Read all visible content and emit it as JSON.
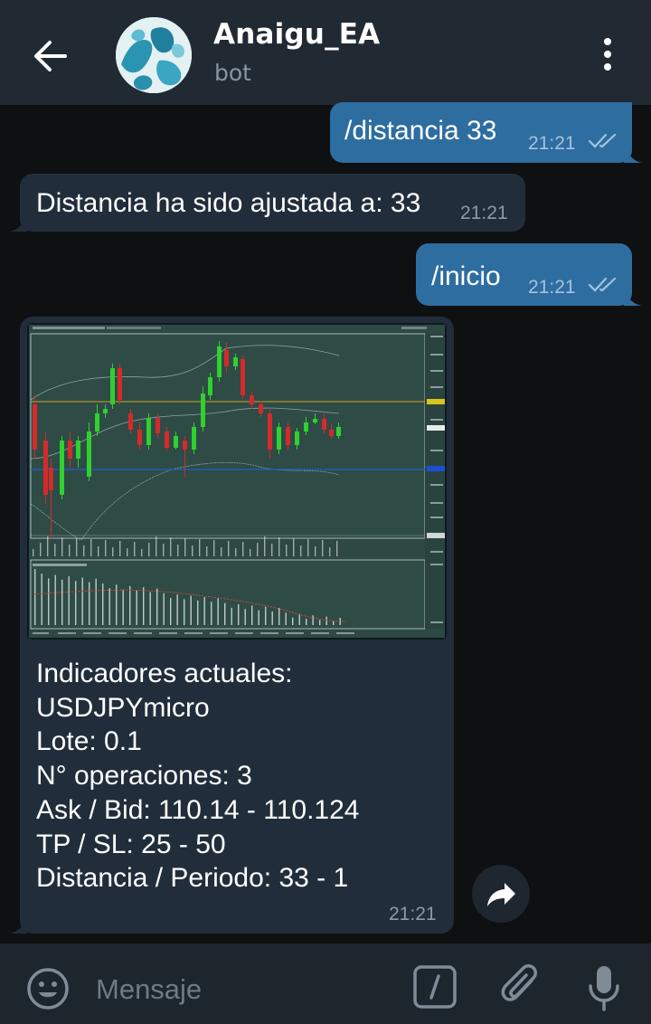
{
  "header": {
    "title": "Anaigu_EA",
    "subtitle": "bot",
    "avatar_icon": "bot-avatar-image"
  },
  "messages": [
    {
      "direction": "out",
      "text": "/distancia 33",
      "time": "21:21",
      "status": "read"
    },
    {
      "direction": "in",
      "text": "Distancia ha sido ajustada a: 33",
      "time": "21:21"
    },
    {
      "direction": "out",
      "text": "/inicio",
      "time": "21:21",
      "status": "read"
    },
    {
      "direction": "in",
      "type": "photo",
      "caption_lines": [
        "Indicadores actuales:",
        "USDJPYmicro",
        "Lote: 0.1",
        "N° operaciones: 3",
        "Ask / Bid: 110.14 - 110.124",
        "TP / SL: 25 - 50",
        "Distancia / Periodo: 33 - 1"
      ],
      "time": "21:21",
      "chart_colors": {
        "background": "#0a1416",
        "bull": "#2fd12f",
        "bear": "#d42a2a",
        "level": "#c8a520",
        "bid_line": "#1c5fd0"
      }
    }
  ],
  "input": {
    "placeholder": "Mensaje"
  },
  "icons": {
    "back": "arrow-left-icon",
    "menu": "more-vertical-icon",
    "forward": "share-forward-icon",
    "emoji": "emoji-icon",
    "command": "slash-command-icon",
    "attach": "paperclip-icon",
    "mic": "microphone-icon"
  },
  "colors": {
    "header": "#212a33",
    "background": "#0e1012",
    "bubble_out": "#2e6da0",
    "bubble_in": "#212d3b",
    "input_bar": "#1d252d"
  }
}
